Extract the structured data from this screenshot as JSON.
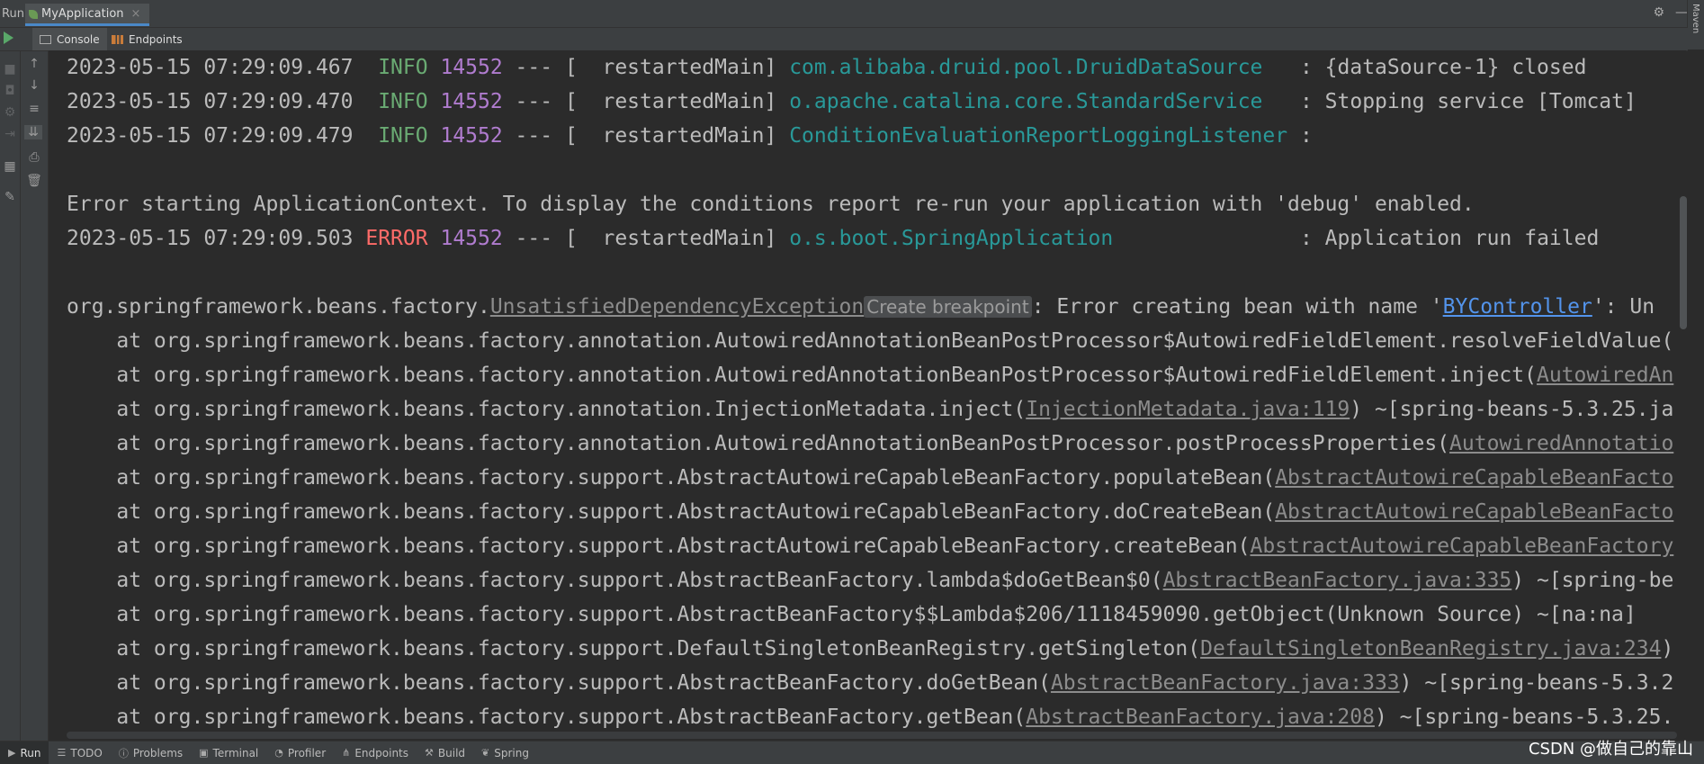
{
  "run_bar": {
    "label": "Run:",
    "app_tab": "MyApplication",
    "close_symbol": "×",
    "right_icons": [
      "gear-icon",
      "minimize-icon"
    ],
    "side_panel": "Maven"
  },
  "sub_tabs": [
    {
      "label": "Console",
      "icon": "console-icon",
      "active": true
    },
    {
      "label": "Endpoints",
      "icon": "endpoints-icon",
      "active": false
    }
  ],
  "tooltip": "Create breakpoint",
  "log": {
    "lines": [
      {
        "ts": "2023-05-15 07:29:09.467",
        "level": "INFO",
        "pid": "14552",
        "sep": " --- [  restartedMain] ",
        "logger": "com.alibaba.druid.pool.DruidDataSource",
        "pad": "   ",
        "msg": ": {dataSource-1} closed"
      },
      {
        "ts": "2023-05-15 07:29:09.470",
        "level": "INFO",
        "pid": "14552",
        "sep": " --- [  restartedMain] ",
        "logger": "o.apache.catalina.core.StandardService",
        "pad": "   ",
        "msg": ": Stopping service [Tomcat]"
      },
      {
        "ts": "2023-05-15 07:29:09.479",
        "level": "INFO",
        "pid": "14552",
        "sep": " --- [  restartedMain] ",
        "logger": "ConditionEvaluationReportLoggingListener",
        "pad": " ",
        "msg": ":"
      }
    ],
    "error_context": "Error starting ApplicationContext. To display the conditions report re-run your application with 'debug' enabled.",
    "error_line": {
      "ts": "2023-05-15 07:29:09.503",
      "level": "ERROR",
      "pid": "14552",
      "sep": " --- [  restartedMain] ",
      "logger": "o.s.boot.SpringApplication",
      "pad": "               ",
      "msg": ": Application run failed"
    },
    "exception": {
      "prefix": "org.springframework.beans.factory.",
      "name": "UnsatisfiedDependencyException",
      "mid": ": Error creating bean with name '",
      "bean": "BYController",
      "tail": "': Un"
    },
    "stack": [
      {
        "text": "    at org.springframework.beans.factory.annotation.AutowiredAnnotationBeanPostProcessor$AutowiredFieldElement.resolveFieldValue(",
        "link": "",
        "after": ""
      },
      {
        "text": "    at org.springframework.beans.factory.annotation.AutowiredAnnotationBeanPostProcessor$AutowiredFieldElement.inject(",
        "link": "AutowiredAn",
        "after": ""
      },
      {
        "text": "    at org.springframework.beans.factory.annotation.InjectionMetadata.inject(",
        "link": "InjectionMetadata.java:119",
        "after": ") ~[spring-beans-5.3.25.ja"
      },
      {
        "text": "    at org.springframework.beans.factory.annotation.AutowiredAnnotationBeanPostProcessor.postProcessProperties(",
        "link": "AutowiredAnnotatio",
        "after": ""
      },
      {
        "text": "    at org.springframework.beans.factory.support.AbstractAutowireCapableBeanFactory.populateBean(",
        "link": "AbstractAutowireCapableBeanFacto",
        "after": ""
      },
      {
        "text": "    at org.springframework.beans.factory.support.AbstractAutowireCapableBeanFactory.doCreateBean(",
        "link": "AbstractAutowireCapableBeanFacto",
        "after": ""
      },
      {
        "text": "    at org.springframework.beans.factory.support.AbstractAutowireCapableBeanFactory.createBean(",
        "link": "AbstractAutowireCapableBeanFactory",
        "after": ""
      },
      {
        "text": "    at org.springframework.beans.factory.support.AbstractBeanFactory.lambda$doGetBean$0(",
        "link": "AbstractBeanFactory.java:335",
        "after": ") ~[spring-be"
      },
      {
        "text": "    at org.springframework.beans.factory.support.AbstractBeanFactory$$Lambda$206/1118459090.getObject(Unknown Source) ~[na:na]",
        "link": "",
        "after": ""
      },
      {
        "text": "    at org.springframework.beans.factory.support.DefaultSingletonBeanRegistry.getSingleton(",
        "link": "DefaultSingletonBeanRegistry.java:234",
        "after": ")"
      },
      {
        "text": "    at org.springframework.beans.factory.support.AbstractBeanFactory.doGetBean(",
        "link": "AbstractBeanFactory.java:333",
        "after": ") ~[spring-beans-5.3.2"
      },
      {
        "text": "    at org.springframework.beans.factory.support.AbstractBeanFactory.getBean(",
        "link": "AbstractBeanFactory.java:208",
        "after": ") ~[spring-beans-5.3.25."
      }
    ]
  },
  "status_bar": [
    {
      "label": "Run",
      "icon": "run-icon",
      "active": true
    },
    {
      "label": "TODO",
      "icon": "todo-icon",
      "active": false
    },
    {
      "label": "Problems",
      "icon": "problems-icon",
      "active": false
    },
    {
      "label": "Terminal",
      "icon": "terminal-icon",
      "active": false
    },
    {
      "label": "Profiler",
      "icon": "profiler-icon",
      "active": false
    },
    {
      "label": "Endpoints",
      "icon": "endpoints-icon",
      "active": false
    },
    {
      "label": "Build",
      "icon": "build-icon",
      "active": false
    },
    {
      "label": "Spring",
      "icon": "spring-icon",
      "active": false
    }
  ],
  "watermark": "CSDN @做自己的靠山",
  "colors": {
    "background": "#2b2b2b",
    "panel": "#3c3f41",
    "info": "#6aab73",
    "error": "#ff6b68",
    "pid": "#b07ccf",
    "logger": "#299999",
    "link": "#5394ec"
  }
}
